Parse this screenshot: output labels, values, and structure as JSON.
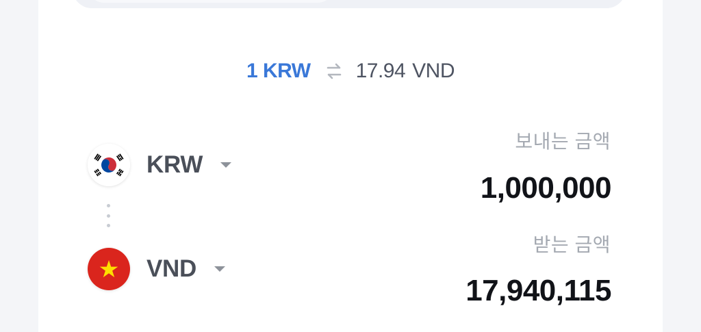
{
  "rate": {
    "from": "1 KRW",
    "to_value": "17.94",
    "to_currency": "VND",
    "swap_icon": "swap-arrows-icon"
  },
  "send": {
    "currency": "KRW",
    "label": "보내는 금액",
    "amount": "1,000,000",
    "flag_icon": "south-korea-flag-icon"
  },
  "receive": {
    "currency": "VND",
    "label": "받는 금액",
    "amount": "17,940,115",
    "flag_icon": "vietnam-flag-icon"
  },
  "colors": {
    "accent": "#3a78d8",
    "text_primary": "#111318",
    "text_secondary": "#4a4f59",
    "label": "#a4a9b1"
  }
}
